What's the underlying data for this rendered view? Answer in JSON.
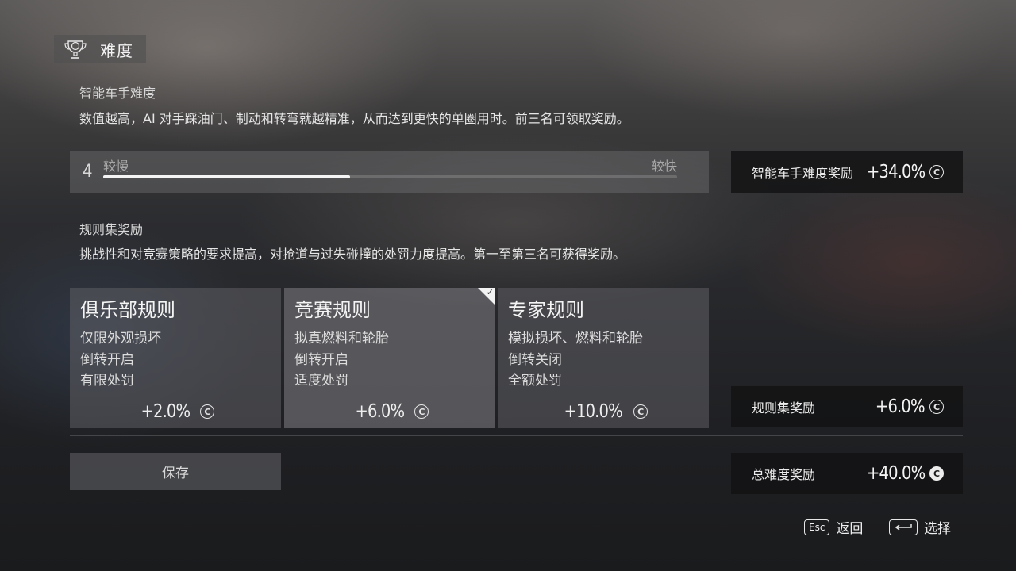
{
  "header": {
    "title": "难度",
    "icon": "trophy-icon"
  },
  "ai_section": {
    "heading": "智能车手难度",
    "description": "数值越高，AI 对手踩油门、制动和转弯就越精准，从而达到更快的单圈用时。前三名可领取奖励。",
    "slider": {
      "value": "4",
      "label_left": "较慢",
      "label_right": "较快",
      "fill_fraction": 0.43
    },
    "bonus": {
      "label": "智能车手难度奖励",
      "value": "+34.0%"
    }
  },
  "rules_section": {
    "heading": "规则集奖励",
    "description": "挑战性和对竞赛策略的要求提高，对抢道与过失碰撞的处罚力度提高。第一至第三名可获得奖励。",
    "cards": [
      {
        "title": "俱乐部规则",
        "lines": [
          "仅限外观损坏",
          "倒转开启",
          "有限处罚"
        ],
        "bonus": "+2.0%",
        "selected": false
      },
      {
        "title": "竞赛规则",
        "lines": [
          "拟真燃料和轮胎",
          "倒转开启",
          "适度处罚"
        ],
        "bonus": "+6.0%",
        "selected": true
      },
      {
        "title": "专家规则",
        "lines": [
          "模拟损坏、燃料和轮胎",
          "倒转关闭",
          "全额处罚"
        ],
        "bonus": "+10.0%",
        "selected": false
      }
    ],
    "bonus": {
      "label": "规则集奖励",
      "value": "+6.0%"
    }
  },
  "total": {
    "label": "总难度奖励",
    "value": "+40.0%"
  },
  "save_button": {
    "label": "保存"
  },
  "footer": {
    "back_key": "Esc",
    "back_label": "返回",
    "select_label": "选择"
  },
  "colors": {
    "panel_dark": "#121214",
    "text_primary": "#f4f4f4",
    "slider_fill": "#f4f4f4"
  }
}
